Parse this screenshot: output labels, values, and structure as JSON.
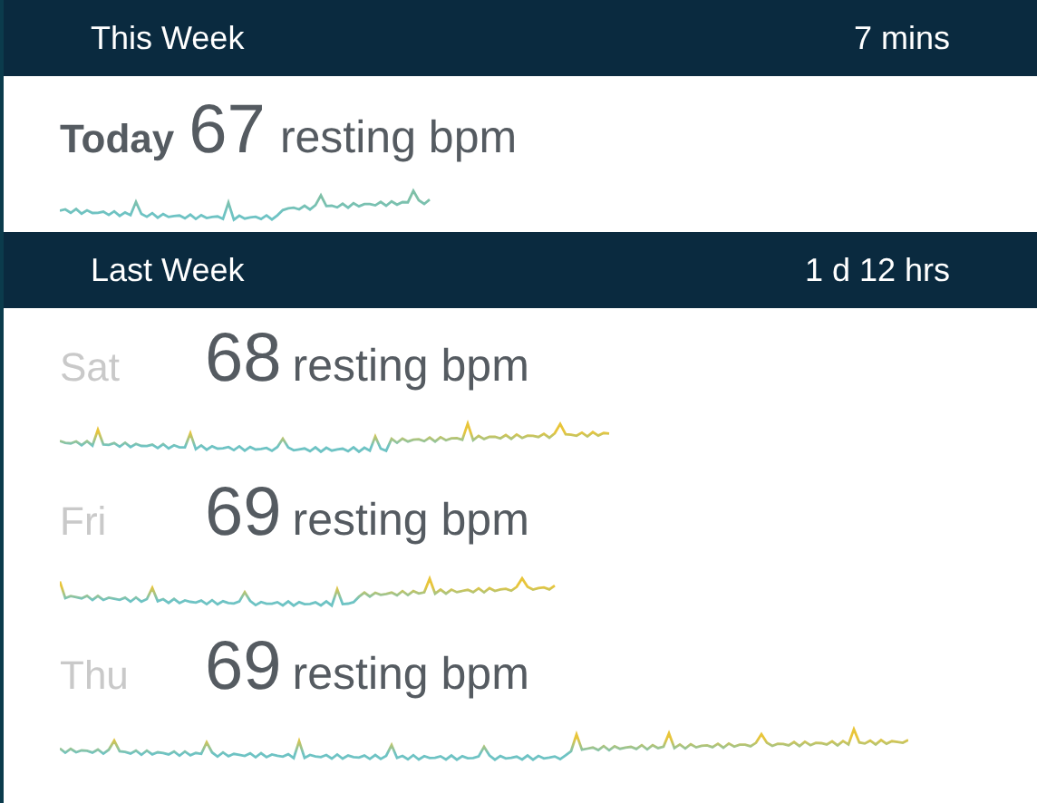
{
  "sections": [
    {
      "title": "This Week",
      "duration": "7 mins",
      "rows": [
        {
          "kind": "today",
          "label": "Today",
          "bpm": "67",
          "unit": "resting bpm"
        }
      ]
    },
    {
      "title": "Last Week",
      "duration": "1 d 12 hrs",
      "rows": [
        {
          "kind": "day",
          "label": "Sat",
          "bpm": "68",
          "unit": "resting bpm"
        },
        {
          "kind": "day",
          "label": "Fri",
          "bpm": "69",
          "unit": "resting bpm"
        },
        {
          "kind": "day",
          "label": "Thu",
          "bpm": "69",
          "unit": "resting bpm"
        }
      ]
    }
  ]
}
